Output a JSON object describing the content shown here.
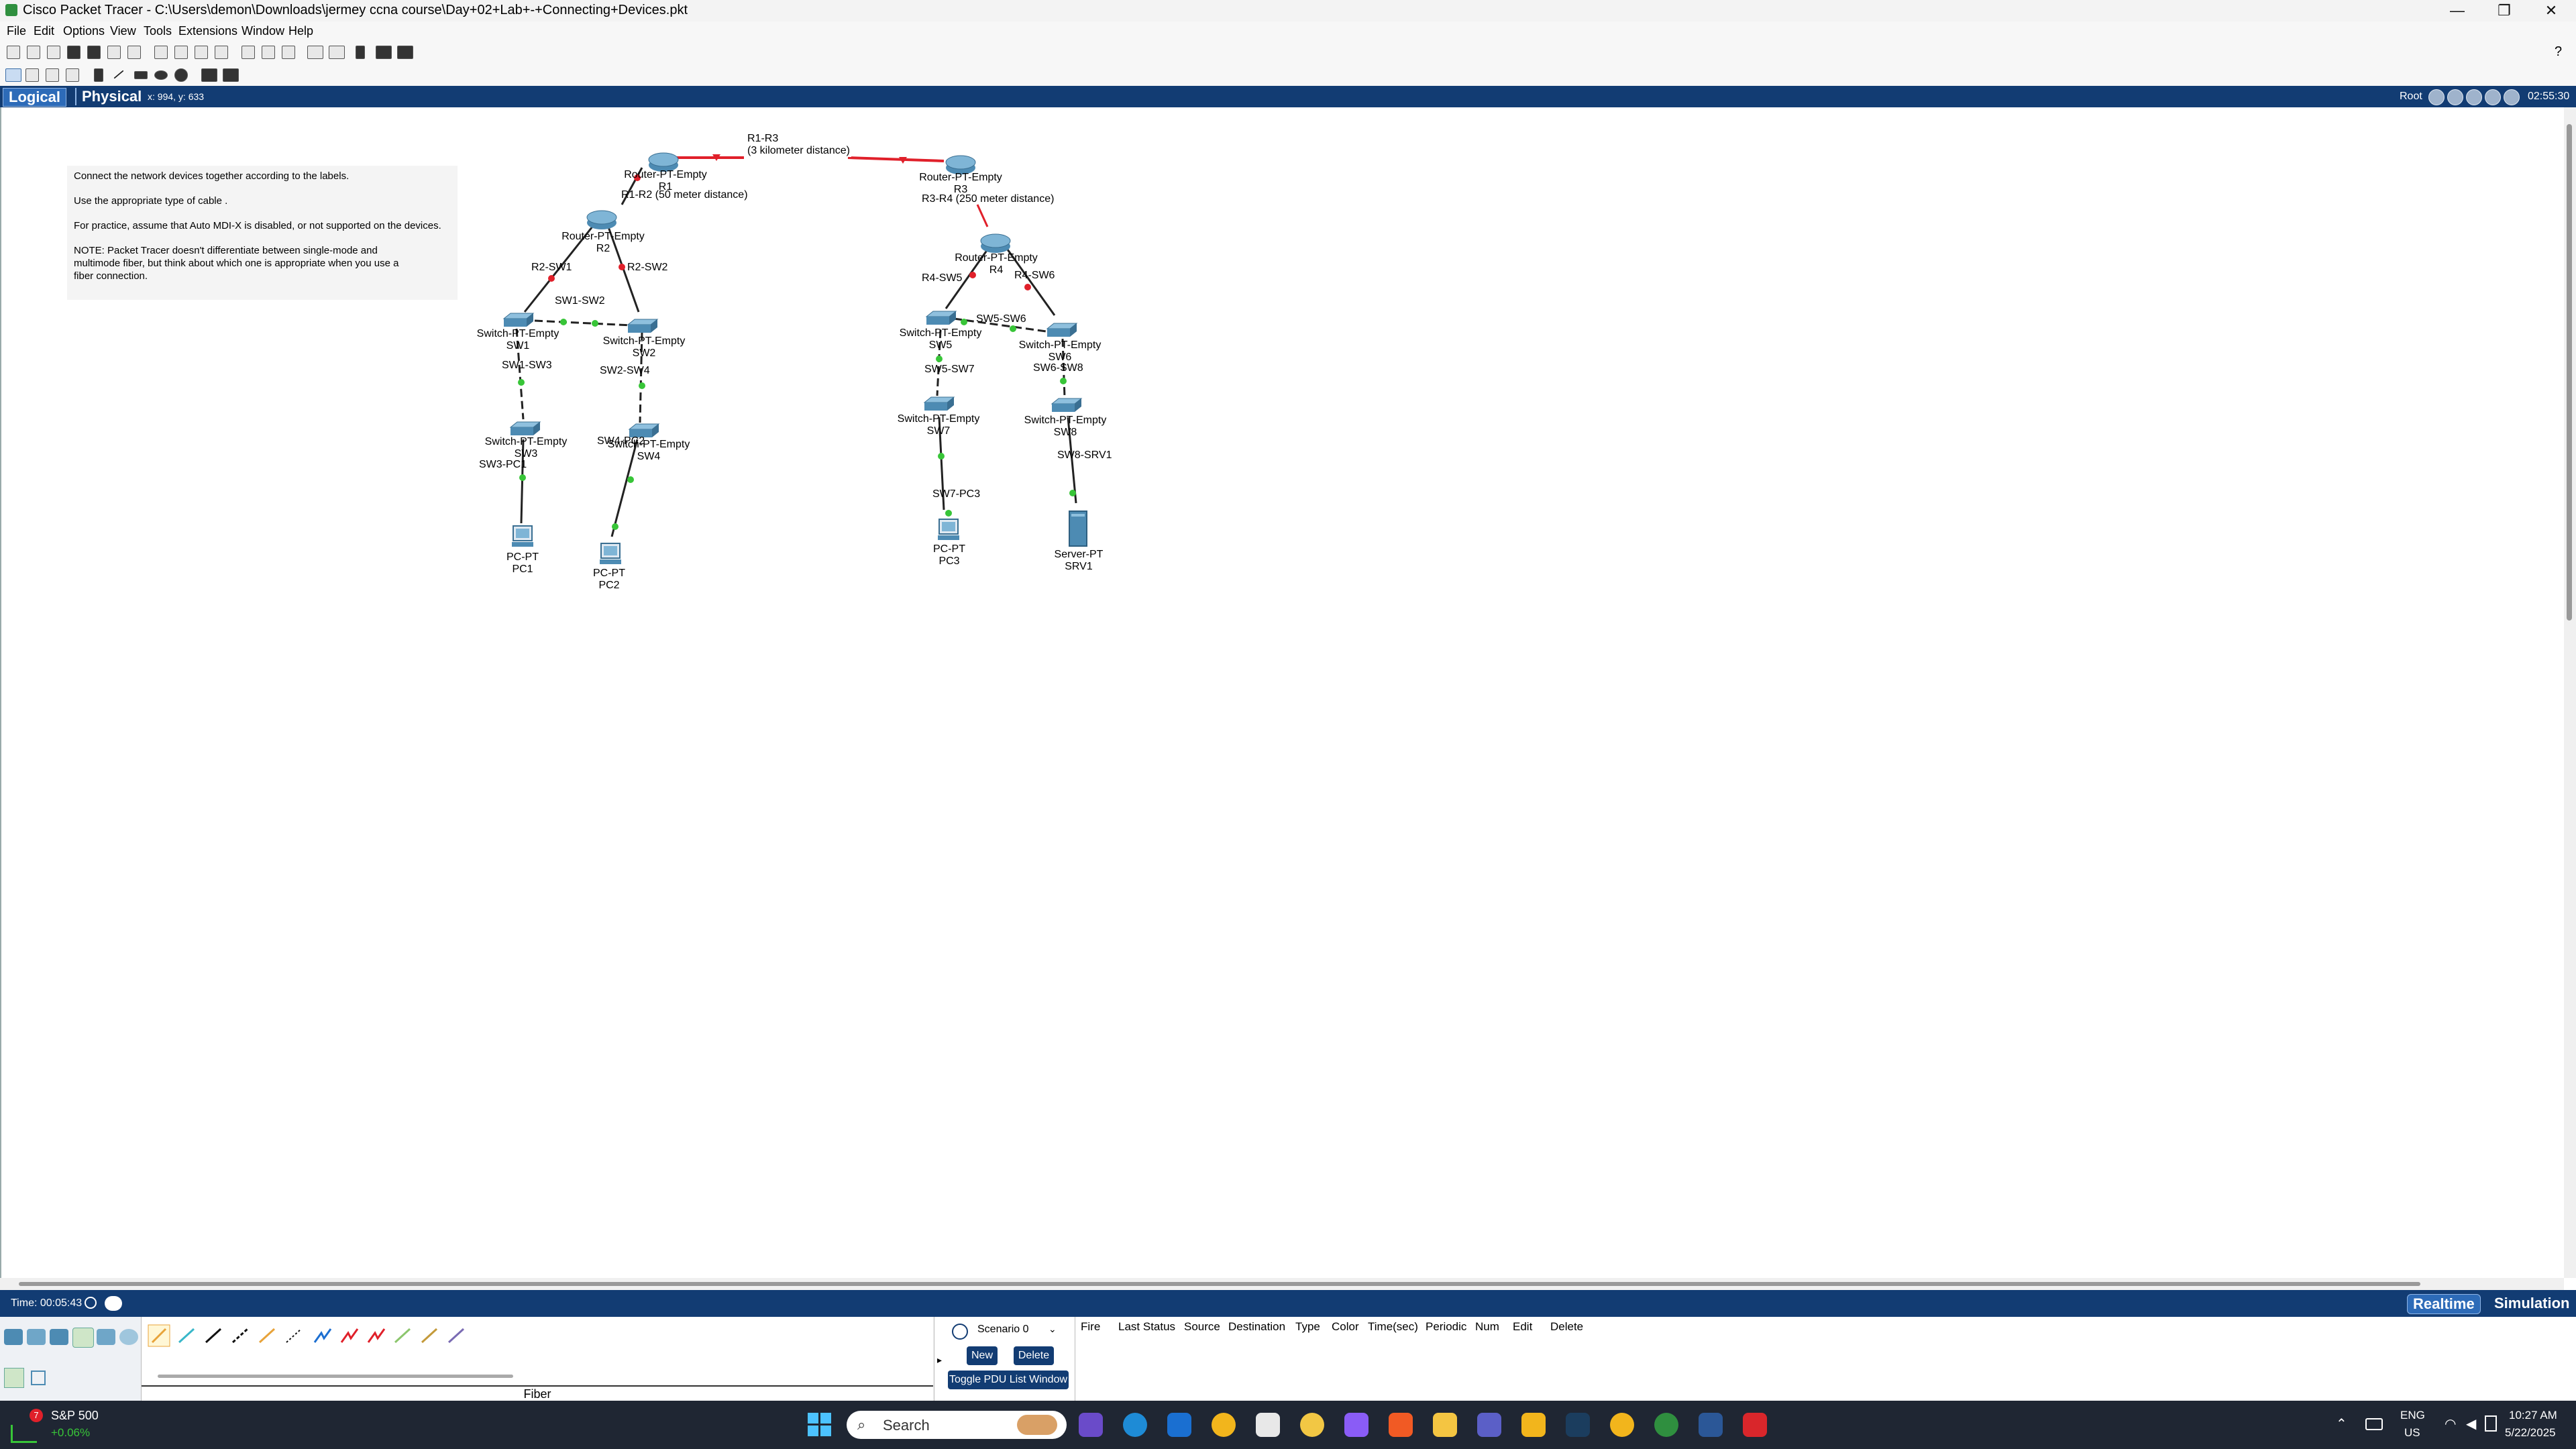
{
  "window": {
    "title": "Cisco Packet Tracer - C:\\Users\\demon\\Downloads\\jermey ccna course\\Day+02+Lab+-+Connecting+Devices.pkt",
    "minimize": "—",
    "maximize": "❐",
    "close": "✕"
  },
  "menu": [
    "File",
    "Edit",
    "Options",
    "View",
    "Tools",
    "Extensions",
    "Window",
    "Help"
  ],
  "help_glyph": "?",
  "workspace": {
    "logical_tab": "Logical",
    "physical_tab": "Physical",
    "coords": "x: 994, y: 633",
    "root": "Root",
    "clock": "02:55:30"
  },
  "note": {
    "lines": [
      "Connect the network devices together according to the labels.",
      "Use the appropriate type of cable .",
      "For practice, assume that Auto MDI-X is disabled, or not supported on the devices.",
      "NOTE: Packet Tracer doesn't differentiate between single-mode and multimode fiber, but think about which one is appropriate when you use a fiber connection."
    ]
  },
  "topology": {
    "devices": [
      {
        "type": "Router-PT-Empty",
        "name": "R1"
      },
      {
        "type": "Router-PT-Empty",
        "name": "R2"
      },
      {
        "type": "Router-PT-Empty",
        "name": "R3"
      },
      {
        "type": "Router-PT-Empty",
        "name": "R4"
      },
      {
        "type": "Switch-PT-Empty",
        "name": "SW1"
      },
      {
        "type": "Switch-PT-Empty",
        "name": "SW2"
      },
      {
        "type": "Switch-PT-Empty",
        "name": "SW3"
      },
      {
        "type": "Switch-PT-Empty",
        "name": "SW4"
      },
      {
        "type": "Switch-PT-Empty",
        "name": "SW5"
      },
      {
        "type": "Switch-PT-Empty",
        "name": "SW6"
      },
      {
        "type": "Switch-PT-Empty",
        "name": "SW7"
      },
      {
        "type": "Switch-PT-Empty",
        "name": "SW8"
      },
      {
        "type": "PC-PT",
        "name": "PC1"
      },
      {
        "type": "PC-PT",
        "name": "PC2"
      },
      {
        "type": "PC-PT",
        "name": "PC3"
      },
      {
        "type": "Server-PT",
        "name": "SRV1"
      }
    ],
    "link_labels": {
      "r1_r3": "R1-R3",
      "r1_r3_distance": "(3 kilometer distance)",
      "r1_r2": "R1-R2 (50 meter distance)",
      "r3_r4": "R3-R4 (250 meter distance)",
      "r2_sw1": "R2-SW1",
      "r2_sw2": "R2-SW2",
      "sw1_sw2": "SW1-SW2",
      "sw1_sw3": "SW1-SW3",
      "sw2_sw4": "SW2-SW4",
      "sw3_pc1": "SW3-PC1",
      "sw4_pc2": "SW4-PC2",
      "r4_sw5": "R4-SW5",
      "r4_sw6": "R4-SW6",
      "sw5_sw6": "SW5-SW6",
      "sw5_sw7": "SW5-SW7",
      "sw6_sw8": "SW6-SW8",
      "sw7_pc3": "SW7-PC3",
      "sw8_srv1": "SW8-SRV1"
    }
  },
  "bottom": {
    "time": "Time: 00:05:43",
    "realtime": "Realtime",
    "simulation": "Simulation",
    "cable_category": "Fiber",
    "scenario": "Scenario 0",
    "new_btn": "New",
    "delete_btn": "Delete",
    "toggle_btn": "Toggle PDU List Window",
    "pdu_headers": [
      "Fire",
      "Last Status",
      "Source",
      "Destination",
      "Type",
      "Color",
      "Time(sec)",
      "Periodic",
      "Num",
      "Edit",
      "Delete"
    ]
  },
  "taskbar": {
    "stock_name": "S&P 500",
    "stock_change": "+0.06%",
    "stock_badge": "7",
    "search_placeholder": "Search",
    "lang_top": "ENG",
    "lang_bottom": "US",
    "time": "10:27 AM",
    "date": "5/22/2025"
  },
  "colors": {
    "navy": "#123c73",
    "link_red": "#e0202a",
    "link_green": "#38c538",
    "taskbar": "#1f2633"
  }
}
